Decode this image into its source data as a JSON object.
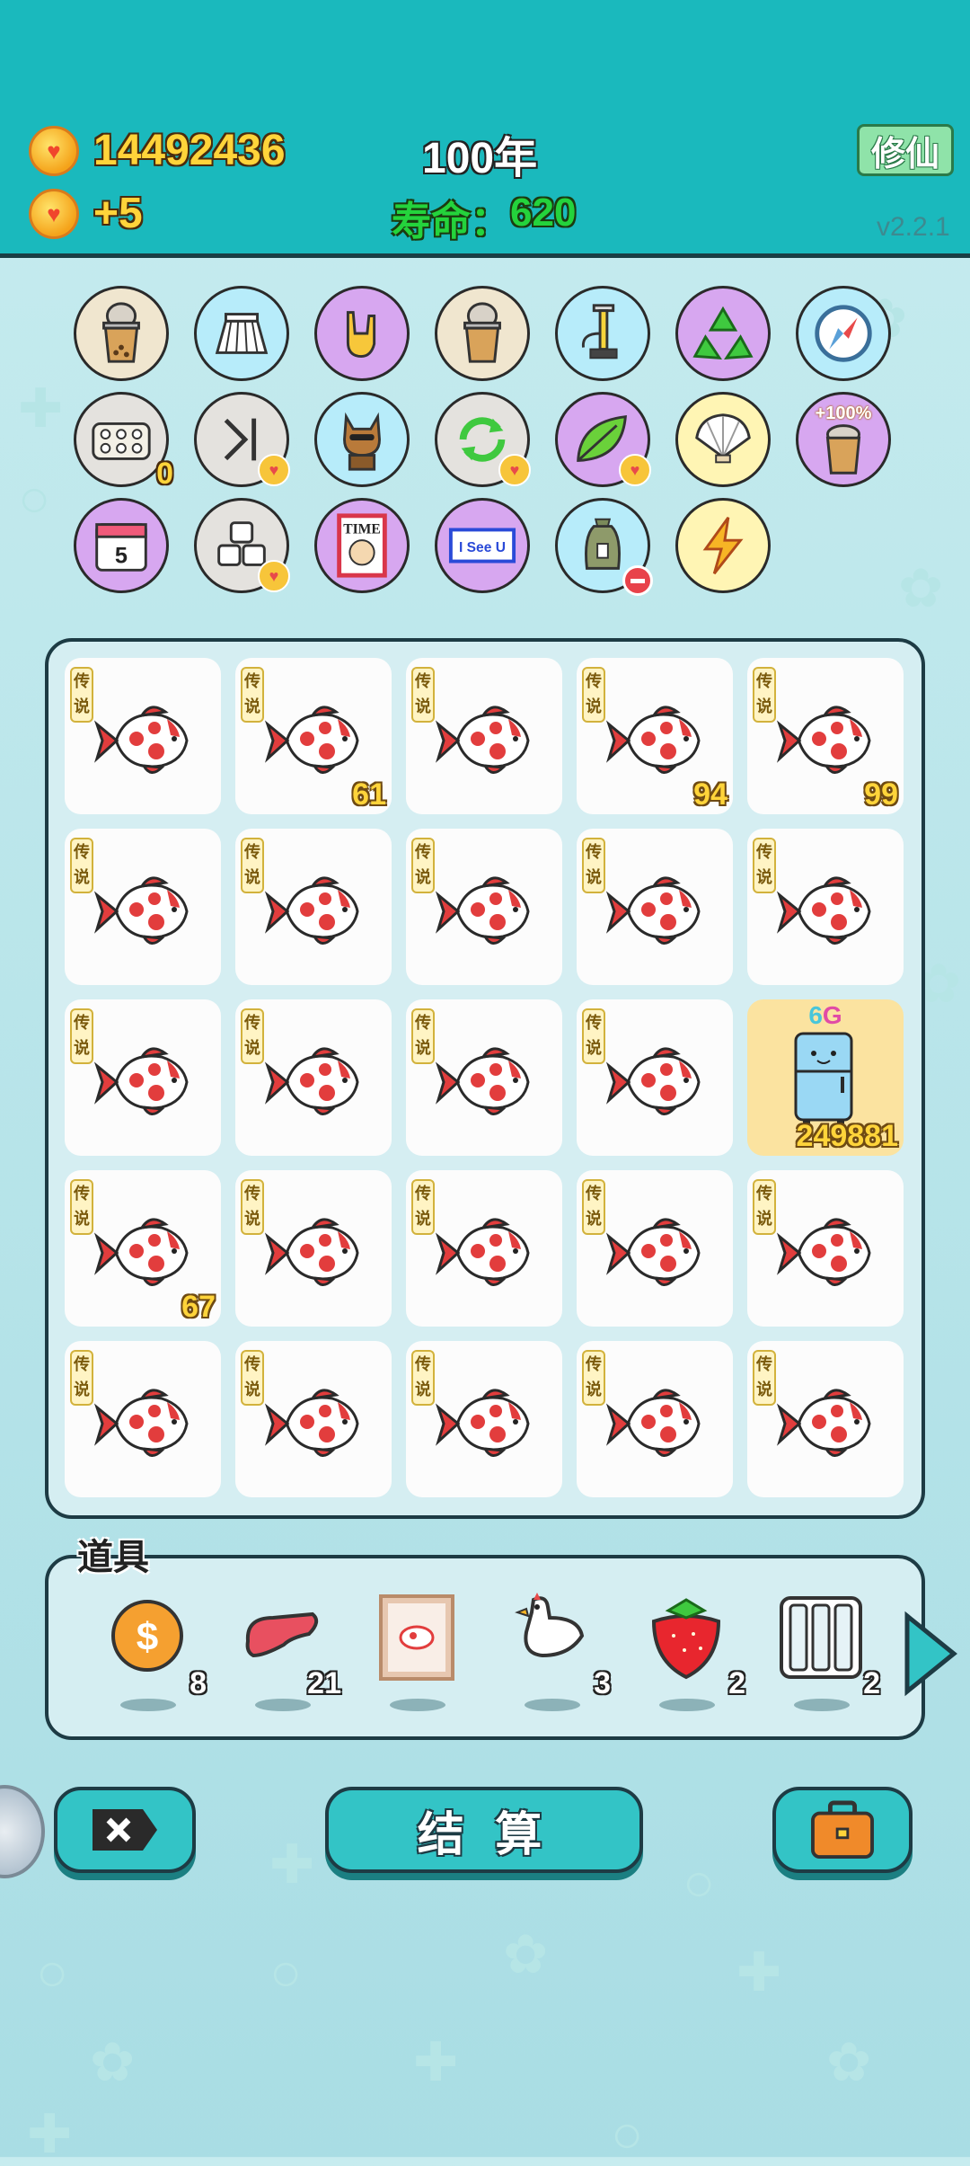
{
  "header": {
    "gold_total": "14492436",
    "gold_income": "+5",
    "year": "100年",
    "life_label": "寿命：",
    "life_value": "620",
    "cultivate_button": "修仙",
    "version": "v2.2.1"
  },
  "skills": [
    {
      "icon": "bubble-tea-icon"
    },
    {
      "icon": "pleated-skirt-icon"
    },
    {
      "icon": "rock-hand-icon"
    },
    {
      "icon": "bubble-tea-icon"
    },
    {
      "icon": "air-pump-icon"
    },
    {
      "icon": "recycle-icon"
    },
    {
      "icon": "compass-icon"
    },
    {
      "icon": "egg-tray-icon",
      "count": "0"
    },
    {
      "icon": "skip-icon"
    },
    {
      "icon": "shiba-dog-icon"
    },
    {
      "icon": "refresh-icon"
    },
    {
      "icon": "leaf-icon"
    },
    {
      "icon": "shell-icon"
    },
    {
      "icon": "bubble-tea-bonus-icon",
      "label": "+100%"
    },
    {
      "icon": "calendar-icon",
      "label": "5"
    },
    {
      "icon": "sugar-cubes-icon"
    },
    {
      "icon": "time-magazine-icon",
      "label": "TIME"
    },
    {
      "icon": "i-see-u-icon",
      "label": "I See U"
    },
    {
      "icon": "trash-bag-icon"
    },
    {
      "icon": "lightning-icon"
    }
  ],
  "board": {
    "tag": "传说",
    "tiles": [
      {
        "icon": "koi-fish-icon",
        "count": ""
      },
      {
        "icon": "koi-fish-icon",
        "count": "61"
      },
      {
        "icon": "koi-fish-icon",
        "count": ""
      },
      {
        "icon": "koi-fish-icon",
        "count": "94"
      },
      {
        "icon": "koi-fish-icon",
        "count": "99"
      },
      {
        "icon": "koi-fish-icon",
        "count": ""
      },
      {
        "icon": "koi-fish-icon",
        "count": ""
      },
      {
        "icon": "koi-fish-icon",
        "count": ""
      },
      {
        "icon": "koi-fish-icon",
        "count": ""
      },
      {
        "icon": "koi-fish-icon",
        "count": ""
      },
      {
        "icon": "koi-fish-icon",
        "count": ""
      },
      {
        "icon": "koi-fish-icon",
        "count": ""
      },
      {
        "icon": "koi-fish-icon",
        "count": ""
      },
      {
        "icon": "koi-fish-icon",
        "count": ""
      },
      {
        "icon": "fridge-icon",
        "count": "249881",
        "badge_six": "6",
        "badge_g": "G"
      },
      {
        "icon": "koi-fish-icon",
        "count": "67"
      },
      {
        "icon": "koi-fish-icon",
        "count": ""
      },
      {
        "icon": "koi-fish-icon",
        "count": ""
      },
      {
        "icon": "koi-fish-icon",
        "count": ""
      },
      {
        "icon": "koi-fish-icon",
        "count": ""
      },
      {
        "icon": "koi-fish-icon",
        "count": ""
      },
      {
        "icon": "koi-fish-icon",
        "count": ""
      },
      {
        "icon": "koi-fish-icon",
        "count": ""
      },
      {
        "icon": "koi-fish-icon",
        "count": ""
      },
      {
        "icon": "koi-fish-icon",
        "count": ""
      }
    ]
  },
  "items": {
    "title": "道具",
    "list": [
      {
        "icon": "dollar-coin-icon",
        "count": "8"
      },
      {
        "icon": "liver-icon",
        "count": "21"
      },
      {
        "icon": "fish-frame-icon",
        "count": ""
      },
      {
        "icon": "white-bird-icon",
        "count": "3"
      },
      {
        "icon": "strawberry-icon",
        "count": "2"
      },
      {
        "icon": "cage-icon",
        "count": "2"
      }
    ]
  },
  "actions": {
    "settle_label": "结 算"
  },
  "colors": {
    "header_bg": "#1ab9bd",
    "button_bg": "#33c4c6",
    "gold_text": "#ffd43a",
    "life_text": "#24d33c",
    "fish_red": "#e23d3d"
  }
}
